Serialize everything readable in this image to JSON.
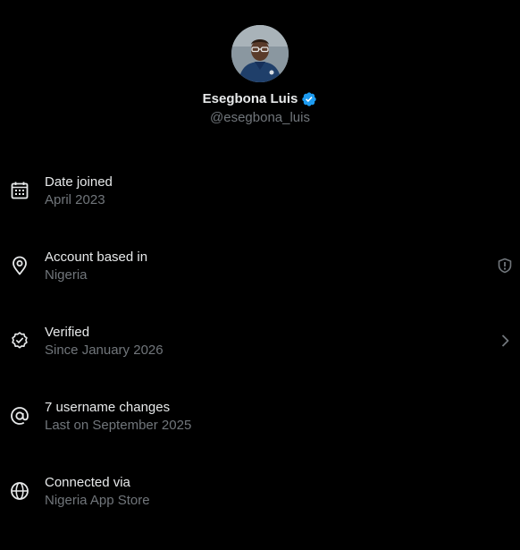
{
  "profile": {
    "display_name": "Esegbona Luis",
    "handle": "@esegbona_luis",
    "avatar": "avatar-photo",
    "verified_badge": "verified-badge-icon",
    "badge_color": "#1d9bf0"
  },
  "rows": [
    {
      "title": "Date joined",
      "subtitle": "April 2023",
      "icon": "calendar-icon"
    },
    {
      "title": "Account based in",
      "subtitle": "Nigeria",
      "icon": "location-pin-icon",
      "trailing_icon": "shield-alert-icon"
    },
    {
      "title": "Verified",
      "subtitle": "Since January 2026",
      "icon": "verified-check-icon",
      "trailing_icon": "chevron-right-icon"
    },
    {
      "title": "7 username changes",
      "subtitle": "Last on September 2025",
      "icon": "at-sign-icon"
    },
    {
      "title": "Connected via",
      "subtitle": "Nigeria App Store",
      "icon": "globe-icon"
    }
  ],
  "colors": {
    "background": "#000000",
    "primary_text": "#e7e9ea",
    "secondary_text": "#71767b"
  }
}
